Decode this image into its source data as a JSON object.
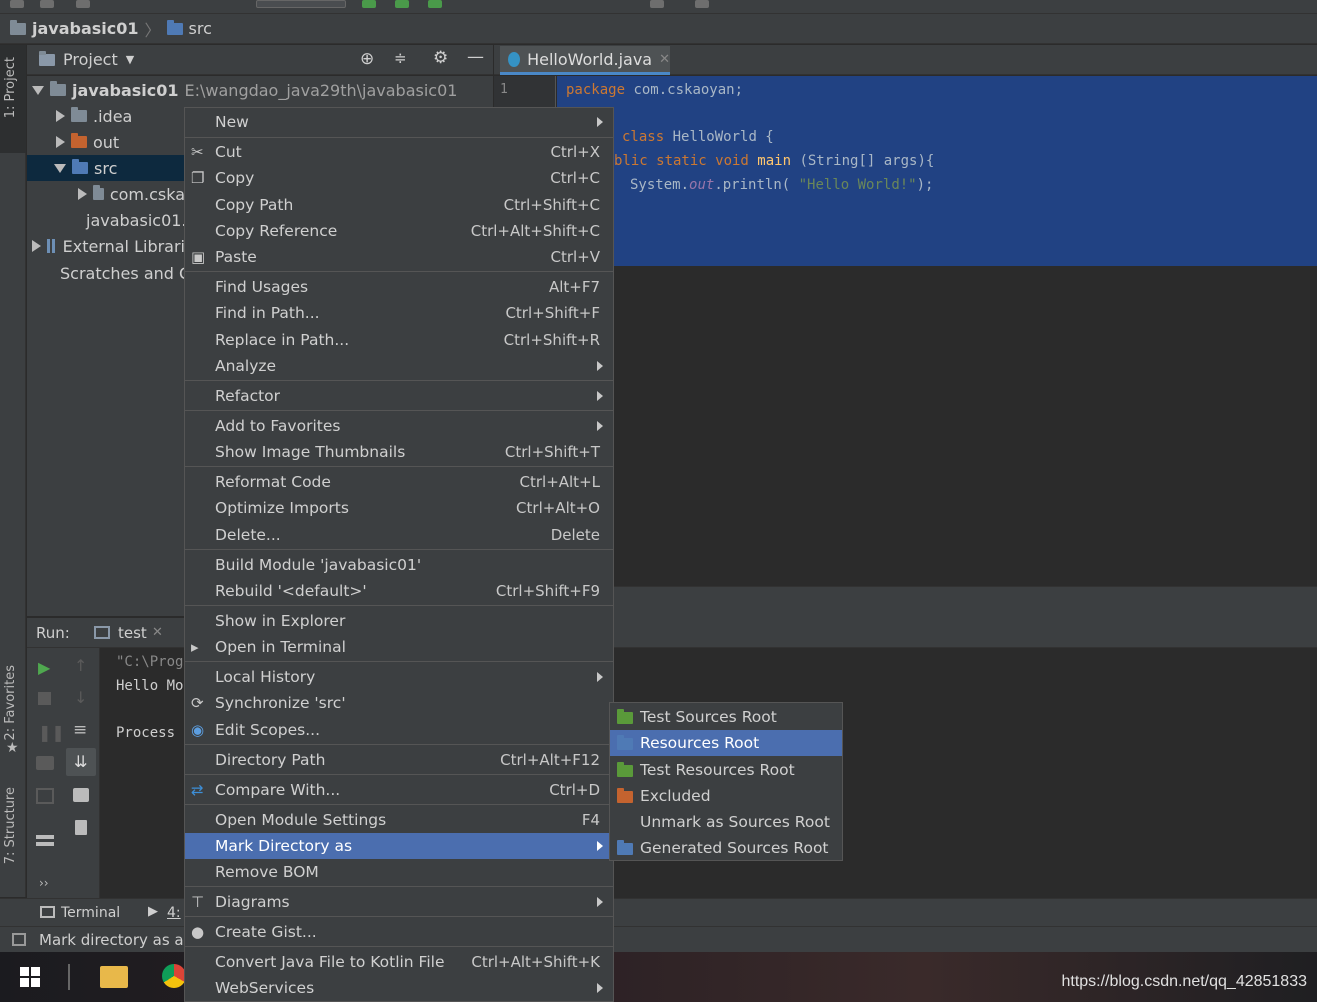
{
  "navbar": {
    "project": "javabasic01",
    "folder": "src"
  },
  "left_stripe": {
    "project": "1: Project",
    "favorites": "2: Favorites",
    "structure": "7: Structure"
  },
  "project_panel": {
    "title": "Project",
    "root_name": "javabasic01",
    "root_path": "E:\\wangdao_java29th\\javabasic01",
    "items": [
      ".idea",
      "out",
      "src",
      "com.cska",
      "javabasic01.",
      "External Librari",
      "Scratches and C"
    ]
  },
  "editor": {
    "tab": "HelloWorld.java",
    "line_number": "1",
    "code": {
      "l1_kw": "package",
      "l1_rest": " com.cskaoyan;",
      "l3_kw": "class",
      "l3_rest": " HelloWorld {",
      "l4_kw1": "blic static void",
      "l4_fn": " main",
      "l4_rest": " (String[] args){",
      "l5_a": "System.",
      "l5_out": "out",
      "l5_b": ".println( ",
      "l5_str": "\"Hello World!\"",
      "l5_c": ");"
    }
  },
  "run_panel": {
    "label": "Run:",
    "tab": "test",
    "console": [
      "\"C:\\Prog",
      "Hello Mo",
      "Process :"
    ]
  },
  "bottom_tabs": {
    "terminal": "Terminal",
    "run": "4:"
  },
  "status": "Mark directory as a",
  "context_menu": [
    {
      "label": "New",
      "shortcut": "",
      "submenu": true
    },
    {
      "label": "Cut",
      "shortcut": "Ctrl+X",
      "icon": "scissors-icon"
    },
    {
      "label": "Copy",
      "shortcut": "Ctrl+C",
      "icon": "copy-icon"
    },
    {
      "label": "Copy Path",
      "shortcut": "Ctrl+Shift+C"
    },
    {
      "label": "Copy Reference",
      "shortcut": "Ctrl+Alt+Shift+C"
    },
    {
      "label": "Paste",
      "shortcut": "Ctrl+V",
      "icon": "clipboard-icon"
    },
    {
      "label": "Find Usages",
      "shortcut": "Alt+F7"
    },
    {
      "label": "Find in Path...",
      "shortcut": "Ctrl+Shift+F"
    },
    {
      "label": "Replace in Path...",
      "shortcut": "Ctrl+Shift+R"
    },
    {
      "label": "Analyze",
      "shortcut": "",
      "submenu": true
    },
    {
      "label": "Refactor",
      "shortcut": "",
      "submenu": true
    },
    {
      "label": "Add to Favorites",
      "shortcut": "",
      "submenu": true
    },
    {
      "label": "Show Image Thumbnails",
      "shortcut": "Ctrl+Shift+T"
    },
    {
      "label": "Reformat Code",
      "shortcut": "Ctrl+Alt+L"
    },
    {
      "label": "Optimize Imports",
      "shortcut": "Ctrl+Alt+O"
    },
    {
      "label": "Delete...",
      "shortcut": "Delete"
    },
    {
      "label": "Build Module 'javabasic01'",
      "shortcut": ""
    },
    {
      "label": "Rebuild '<default>'",
      "shortcut": "Ctrl+Shift+F9"
    },
    {
      "label": "Show in Explorer",
      "shortcut": ""
    },
    {
      "label": "Open in Terminal",
      "shortcut": "",
      "icon": "terminal-icon"
    },
    {
      "label": "Local History",
      "shortcut": "",
      "submenu": true
    },
    {
      "label": "Synchronize 'src'",
      "shortcut": "",
      "icon": "sync-icon"
    },
    {
      "label": "Edit Scopes...",
      "shortcut": "",
      "icon": "scope-icon"
    },
    {
      "label": "Directory Path",
      "shortcut": "Ctrl+Alt+F12"
    },
    {
      "label": "Compare With...",
      "shortcut": "Ctrl+D",
      "icon": "compare-icon"
    },
    {
      "label": "Open Module Settings",
      "shortcut": "F4"
    },
    {
      "label": "Mark Directory as",
      "shortcut": "",
      "submenu": true,
      "selected": true
    },
    {
      "label": "Remove BOM",
      "shortcut": ""
    },
    {
      "label": "Diagrams",
      "shortcut": "",
      "submenu": true,
      "icon": "diagram-icon"
    },
    {
      "label": "Create Gist...",
      "shortcut": "",
      "icon": "github-icon"
    },
    {
      "label": "Convert Java File to Kotlin File",
      "shortcut": "Ctrl+Alt+Shift+K"
    },
    {
      "label": "WebServices",
      "shortcut": "",
      "submenu": true
    }
  ],
  "submenu": [
    {
      "label": "Test Sources Root",
      "icon": "green-folder-icon"
    },
    {
      "label": "Resources Root",
      "icon": "resources-folder-icon",
      "selected": true
    },
    {
      "label": "Test Resources Root",
      "icon": "test-resources-folder-icon"
    },
    {
      "label": "Excluded",
      "icon": "orange-folder-icon"
    },
    {
      "label": "Unmark as Sources Root",
      "icon": ""
    },
    {
      "label": "Generated Sources Root",
      "icon": "generated-folder-icon"
    }
  ],
  "watermark": "https://blog.csdn.net/qq_42851833"
}
